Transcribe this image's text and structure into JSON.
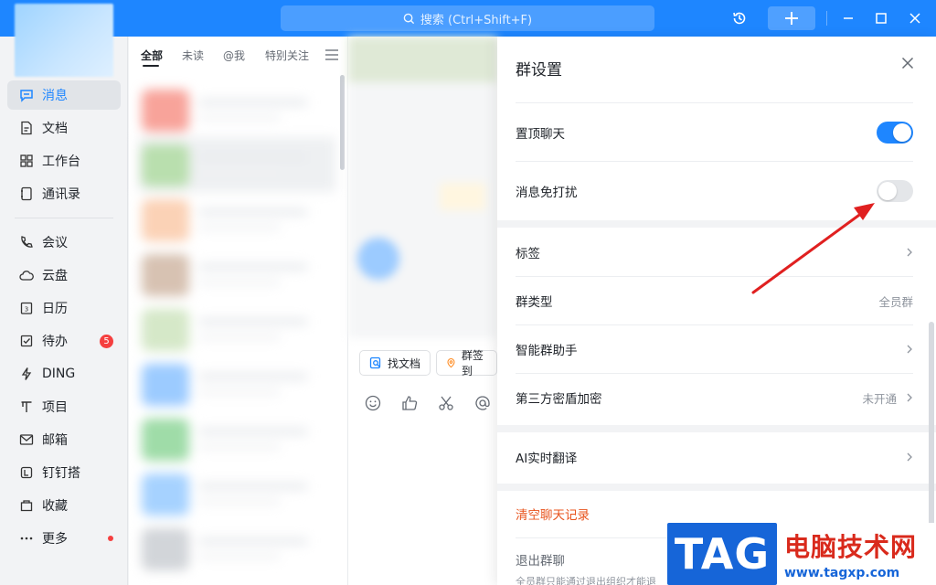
{
  "titlebar": {
    "search_placeholder": "搜索 (Ctrl+Shift+F)"
  },
  "sidebar": {
    "items": [
      {
        "label": "消息",
        "icon": "message-icon",
        "active": true
      },
      {
        "label": "文档",
        "icon": "doc-icon"
      },
      {
        "label": "工作台",
        "icon": "grid-icon"
      },
      {
        "label": "通讯录",
        "icon": "contacts-icon"
      },
      {
        "label": "会议",
        "icon": "phone-icon"
      },
      {
        "label": "云盘",
        "icon": "cloud-icon"
      },
      {
        "label": "日历",
        "icon": "calendar-icon"
      },
      {
        "label": "待办",
        "icon": "todo-icon",
        "badge": "5"
      },
      {
        "label": "DING",
        "icon": "lightning-icon"
      },
      {
        "label": "项目",
        "icon": "project-icon"
      },
      {
        "label": "邮箱",
        "icon": "mail-icon"
      },
      {
        "label": "钉钉搭",
        "icon": "build-icon"
      },
      {
        "label": "收藏",
        "icon": "favorite-icon"
      },
      {
        "label": "更多",
        "icon": "more-icon",
        "dot": true
      }
    ]
  },
  "convlist": {
    "tabs": [
      "全部",
      "未读",
      "@我",
      "特别关注"
    ]
  },
  "chat": {
    "chips": [
      "找文档",
      "群签到"
    ]
  },
  "panel": {
    "title": "群设置",
    "pin_chat": {
      "label": "置顶聊天",
      "on": true
    },
    "dnd": {
      "label": "消息免打扰",
      "on": false
    },
    "tag": {
      "label": "标签"
    },
    "group_type": {
      "label": "群类型",
      "value": "全员群"
    },
    "assistant": {
      "label": "智能群助手"
    },
    "encryption": {
      "label": "第三方密盾加密",
      "value": "未开通"
    },
    "translate": {
      "label": "AI实时翻译"
    },
    "clear_history": {
      "label": "清空聊天记录"
    },
    "exit": {
      "label": "退出群聊",
      "note": "全员群只能通过退出组织才能退"
    }
  },
  "watermark": {
    "tag": "TAG",
    "cn": "电脑技术网",
    "url": "www.tagxp.com"
  },
  "colors": {
    "brand": "#1e86ff",
    "danger": "#e8541e",
    "annotation": "#e02020"
  }
}
